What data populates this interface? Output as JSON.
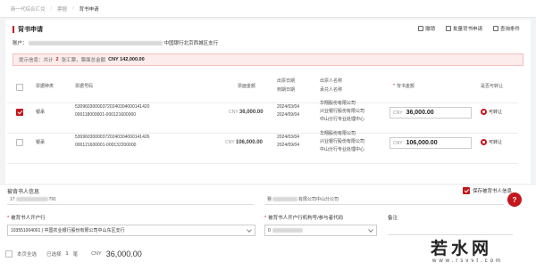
{
  "breadcrumb": {
    "items": [
      "新一代综合汇兑",
      "票据",
      "背书申请"
    ]
  },
  "panel": {
    "title": "背书申请",
    "tools": [
      {
        "label": "撤销"
      },
      {
        "label": "批量背书申请"
      },
      {
        "label": "查询条件"
      }
    ],
    "account_label": "账户：",
    "account_bank": "中国银行北京西城区支行"
  },
  "alert": {
    "prefix": "提示信息：共计",
    "count": "2",
    "mid": "张汇票，票面总金额",
    "amount": "CNY 142,000.00"
  },
  "table": {
    "headers": {
      "type": "票据种类",
      "number": "票据号码",
      "face": "票面金额",
      "dates": [
        "出票日期",
        "到期日期"
      ],
      "drawer": [
        "出票人名称",
        "承兑人名称"
      ],
      "endorse_amt": "背书金额",
      "transfer": "是否可转让"
    },
    "rows": [
      {
        "type": "银承",
        "number": [
          "530960300003720240304000141420",
          "000118000001-000121600000"
        ],
        "face": "36,000.00",
        "face_ccy": "CNY",
        "dates": [
          "2024/03/04",
          "2024/09/04"
        ],
        "drawer": [
          "华翔股份有限公司",
          "兴业银行股份有限公司",
          "中山分行专业处理中心"
        ],
        "endorse_ccy": "CNY",
        "endorse": "36,000.00",
        "transfer": "可转让",
        "checked": true
      },
      {
        "type": "银承",
        "number": [
          "530960300003720240304000141426",
          "000121600001-000132200000"
        ],
        "face": "106,000.00",
        "face_ccy": "CNY",
        "dates": [
          "2024/03/04",
          "2024/09/04"
        ],
        "drawer": [
          "华翔股份有限公司",
          "兴业银行股份有限公司",
          "中山分行专业处理中心"
        ],
        "endorse_ccy": "CNY",
        "endorse": "106,000.00",
        "transfer": "可转让",
        "checked": false
      }
    ]
  },
  "endorsee": {
    "title": "被背书人信息",
    "save_label": "保存被背书人信息",
    "account_value_suffix": "791",
    "name_suffix": "有限公司中山分公司",
    "bank_label": "被背书人开户行",
    "bank_value": "103551004001 | 中国农业银行股份有限公司中山东区支行",
    "bank_code_label": "被背书人开户行机构号/参与者代码",
    "note_label": "备注",
    "help": "?"
  },
  "footer": {
    "check_label": "本页全选",
    "selected_label": "已选择",
    "selected_count": "1",
    "unit": "笔",
    "ccy": "CNY",
    "total": "36,000.00"
  },
  "watermark": {
    "text": "若水网",
    "sub": "www.rsvvt.com"
  },
  "colors": {
    "accent": "#c4161c",
    "alert_bg": "#fdecec"
  }
}
